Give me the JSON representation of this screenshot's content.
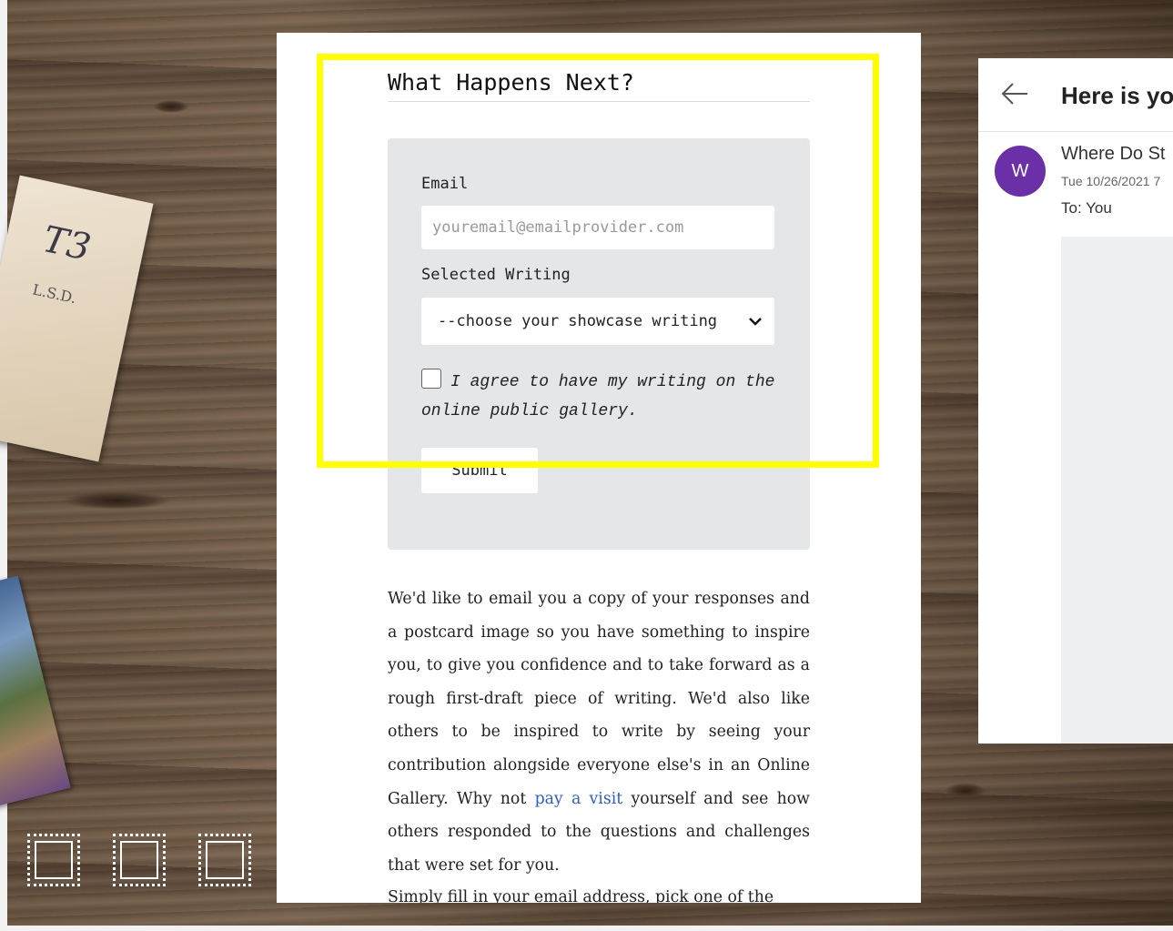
{
  "form_section": {
    "heading": "What Happens Next?",
    "email_label": "Email",
    "email_placeholder": "youremail@emailprovider.com",
    "writing_label": "Selected Writing",
    "writing_select_value": "--choose your showcase writing",
    "agree_text": "I agree to have my writing on the online public gallery.",
    "submit_label": "Submit"
  },
  "body": {
    "paragraph1_before_link": "We'd like to email you a copy of your responses and a postcard image so you have something to inspire you, to give you confidence and to take forward as a rough first-draft piece of writing. We'd also like others to be inspired to write by seeing your contribution alongside everyone else's in an Online Gallery. Why not ",
    "paragraph1_link": "pay a visit",
    "paragraph1_after_link": " yourself and see how others responded to the questions and challenges that were set for you.",
    "paragraph2": "Simply fill in your email address, pick one of the"
  },
  "email_panel": {
    "subject": "Here is yo",
    "avatar_letter": "W",
    "sender": "Where Do St",
    "date": "Tue 10/26/2021 7",
    "to": "To:  You"
  },
  "icons": {
    "back": "back-arrow-icon",
    "chevron": "chevron-down-icon",
    "stamp": "stamp-icon"
  },
  "colors": {
    "highlight": "#ffff00",
    "avatar": "#6b2fa8",
    "link": "#2a5bd7",
    "form_bg": "#e5e6e8"
  }
}
